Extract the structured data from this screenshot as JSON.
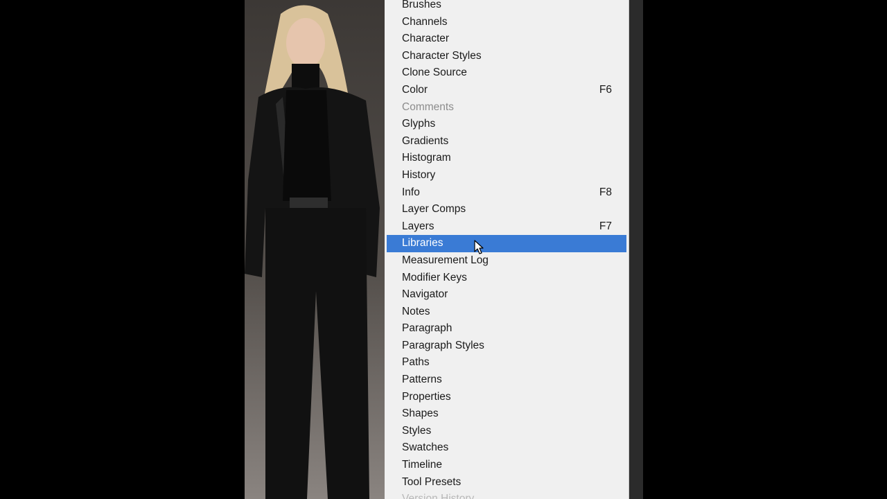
{
  "menu": {
    "items": [
      {
        "label": "Brushes",
        "shortcut": ""
      },
      {
        "label": "Channels",
        "shortcut": ""
      },
      {
        "label": "Character",
        "shortcut": ""
      },
      {
        "label": "Character Styles",
        "shortcut": ""
      },
      {
        "label": "Clone Source",
        "shortcut": ""
      },
      {
        "label": "Color",
        "shortcut": "F6"
      },
      {
        "label": "Comments",
        "shortcut": "",
        "state": "disabled"
      },
      {
        "label": "Glyphs",
        "shortcut": ""
      },
      {
        "label": "Gradients",
        "shortcut": ""
      },
      {
        "label": "Histogram",
        "shortcut": ""
      },
      {
        "label": "History",
        "shortcut": ""
      },
      {
        "label": "Info",
        "shortcut": "F8"
      },
      {
        "label": "Layer Comps",
        "shortcut": ""
      },
      {
        "label": "Layers",
        "shortcut": "F7"
      },
      {
        "label": "Libraries",
        "shortcut": "",
        "state": "selected"
      },
      {
        "label": "Measurement Log",
        "shortcut": ""
      },
      {
        "label": "Modifier Keys",
        "shortcut": ""
      },
      {
        "label": "Navigator",
        "shortcut": ""
      },
      {
        "label": "Notes",
        "shortcut": ""
      },
      {
        "label": "Paragraph",
        "shortcut": ""
      },
      {
        "label": "Paragraph Styles",
        "shortcut": ""
      },
      {
        "label": "Paths",
        "shortcut": ""
      },
      {
        "label": "Patterns",
        "shortcut": ""
      },
      {
        "label": "Properties",
        "shortcut": ""
      },
      {
        "label": "Shapes",
        "shortcut": ""
      },
      {
        "label": "Styles",
        "shortcut": ""
      },
      {
        "label": "Swatches",
        "shortcut": ""
      },
      {
        "label": "Timeline",
        "shortcut": ""
      },
      {
        "label": "Tool Presets",
        "shortcut": ""
      },
      {
        "label": "Version History",
        "shortcut": "",
        "state": "faded"
      }
    ]
  },
  "colors": {
    "menu_background": "#f0f0f0",
    "selected_background": "#3a7bd5",
    "disabled_text": "#8c8c8c"
  },
  "icons": {
    "cursor": "arrow-pointer-icon"
  }
}
